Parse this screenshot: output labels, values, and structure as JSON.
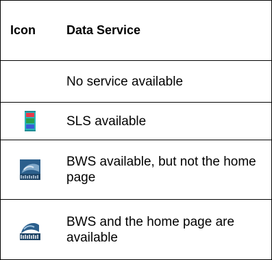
{
  "table": {
    "header": {
      "icon_col": "Icon",
      "service_col": "Data Service"
    },
    "rows": [
      {
        "icon": "none",
        "text": "No service available"
      },
      {
        "icon": "sls-battery-icon",
        "text": "SLS available"
      },
      {
        "icon": "bws-globe-icon",
        "text": "BWS available, but not the home page"
      },
      {
        "icon": "bws-home-icon",
        "text": "BWS and the home page are available"
      }
    ]
  }
}
